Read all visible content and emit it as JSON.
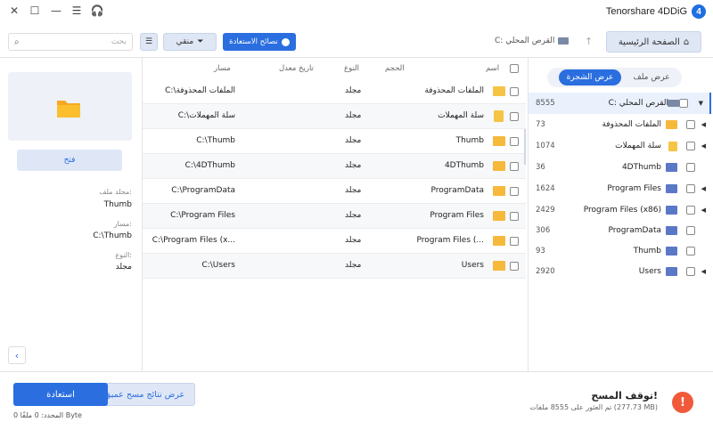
{
  "app": {
    "brand": "Tenorshare 4DDiG"
  },
  "titlebar": {
    "window_icons": [
      "headset-icon",
      "menu-icon",
      "minimize-icon",
      "maximize-icon",
      "close-icon"
    ]
  },
  "toolbar": {
    "home_label": "الصفحة الرئيسية",
    "path_label": "C: القرص المحلي",
    "tips_label": "نصائح الاستعادة",
    "filter_label": "منقي",
    "search_placeholder": "بحث"
  },
  "view_toggle": {
    "file_view": "عرض ملف",
    "tree_view": "عرض الشجرة"
  },
  "tree": [
    {
      "name": "C: القرص المحلي",
      "count": "8555",
      "selected": true
    },
    {
      "name": "الملفات المحذوفة",
      "count": "73"
    },
    {
      "name": "سلة المهملات",
      "count": "1074"
    },
    {
      "name": "4DThumb",
      "count": "36"
    },
    {
      "name": "Program Files",
      "count": "1624"
    },
    {
      "name": "Program Files (x86)",
      "count": "2429"
    },
    {
      "name": "ProgramData",
      "count": "306"
    },
    {
      "name": "Thumb",
      "count": "93"
    },
    {
      "name": "Users",
      "count": "2920"
    }
  ],
  "table": {
    "headers": {
      "name": "اسم",
      "size": "الحجم",
      "type": "النوع",
      "modified": "تاريخ معدل",
      "path": "مسار"
    },
    "rows": [
      {
        "name": "الملفات المحذوفة",
        "type": "مجلد",
        "path": "C:\\الملفات المحذوفة"
      },
      {
        "name": "سلة المهملات",
        "type": "مجلد",
        "path": "C:\\سلة المهملات"
      },
      {
        "name": "Thumb",
        "type": "مجلد",
        "path": "C:\\Thumb"
      },
      {
        "name": "4DThumb",
        "type": "مجلد",
        "path": "C:\\4DThumb"
      },
      {
        "name": "ProgramData",
        "type": "مجلد",
        "path": "C:\\ProgramData"
      },
      {
        "name": "Program Files",
        "type": "مجلد",
        "path": "C:\\Program Files"
      },
      {
        "name": "Program Files (...",
        "type": "مجلد",
        "path": "C:\\Program Files (x..."
      },
      {
        "name": "Users",
        "type": "مجلد",
        "path": "C:\\Users"
      }
    ]
  },
  "preview": {
    "open_label": "فتح",
    "name_label": "مجلد ملف:",
    "name_value": "Thumb",
    "path_label": "مسار:",
    "path_value": "C:\\Thumb",
    "type_label": "النوع:",
    "type_value": "مجلد"
  },
  "bottom": {
    "recover_label": "استعادة",
    "deepscan_label": "عرض نتائج مسح عميق",
    "selected_info": "المحدد: 0 ملفًا 0 Byte",
    "scan_title": "توقف المسح!",
    "scan_sub": "تم العثور على 8555 ملفات (277.73 MB)"
  },
  "colors": {
    "accent": "#2a6ee0",
    "folder": "#f6b93b",
    "stop": "#f05a3a"
  }
}
